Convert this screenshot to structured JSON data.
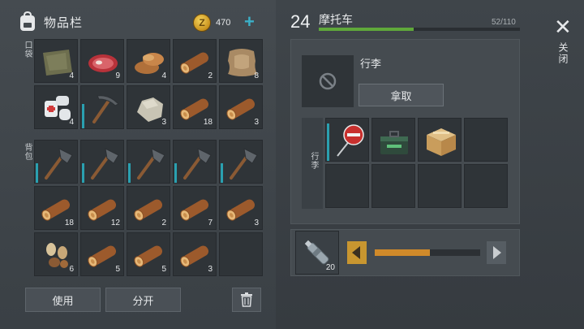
{
  "inventory": {
    "title": "物品栏",
    "coins": "470",
    "pocket_label": "口袋",
    "backpack_label": "背包",
    "pocket_items": [
      {
        "icon": "cloth-icon",
        "qty": "4"
      },
      {
        "icon": "raw-meat-icon",
        "qty": "9"
      },
      {
        "icon": "meat-pile-icon",
        "qty": "4"
      },
      {
        "icon": "log-icon",
        "qty": "2"
      },
      {
        "icon": "hide-icon",
        "qty": "8"
      },
      {
        "icon": "bandage-icon",
        "qty": "4"
      },
      {
        "icon": "pickaxe-icon",
        "qty": ""
      },
      {
        "icon": "stone-icon",
        "qty": "3"
      },
      {
        "icon": "log-icon",
        "qty": "18"
      },
      {
        "icon": "log-icon",
        "qty": "3"
      }
    ],
    "backpack_items": [
      {
        "icon": "hatchet-icon",
        "qty": ""
      },
      {
        "icon": "hatchet-icon",
        "qty": ""
      },
      {
        "icon": "hatchet-icon",
        "qty": ""
      },
      {
        "icon": "hatchet-icon",
        "qty": ""
      },
      {
        "icon": "hatchet-icon",
        "qty": ""
      },
      {
        "icon": "log-icon",
        "qty": "18"
      },
      {
        "icon": "log-icon",
        "qty": "12"
      },
      {
        "icon": "log-icon",
        "qty": "2"
      },
      {
        "icon": "log-icon",
        "qty": "7"
      },
      {
        "icon": "log-icon",
        "qty": "3"
      },
      {
        "icon": "seeds-icon",
        "qty": "6"
      },
      {
        "icon": "log-icon",
        "qty": "5"
      },
      {
        "icon": "log-icon",
        "qty": "5"
      },
      {
        "icon": "log-icon",
        "qty": "3"
      },
      {
        "icon": "",
        "qty": ""
      }
    ],
    "use_label": "使用",
    "split_label": "分开"
  },
  "vehicle": {
    "level": "24",
    "name": "摩托车",
    "capacity_text": "52/110",
    "capacity_fraction": 0.47,
    "luggage_title": "行李",
    "take_label": "拿取",
    "storage_label": "行李",
    "storage_items": [
      {
        "icon": "stop-sign-icon",
        "qty": ""
      },
      {
        "icon": "toolbox-icon",
        "qty": ""
      },
      {
        "icon": "cardboard-box-icon",
        "qty": ""
      },
      {
        "icon": "",
        "qty": ""
      },
      {
        "icon": "",
        "qty": ""
      },
      {
        "icon": "",
        "qty": ""
      },
      {
        "icon": "",
        "qty": ""
      },
      {
        "icon": "",
        "qty": ""
      }
    ]
  },
  "fuel": {
    "item_icon": "bottle-icon",
    "qty": "20",
    "slider_fraction": 0.52
  },
  "close_label": "关闭",
  "colors": {
    "capacity_green": "#5fa83a",
    "slider_orange": "#d08a2a",
    "durability_teal": "#2aa0b0",
    "plus_teal": "#3bb0c8"
  }
}
